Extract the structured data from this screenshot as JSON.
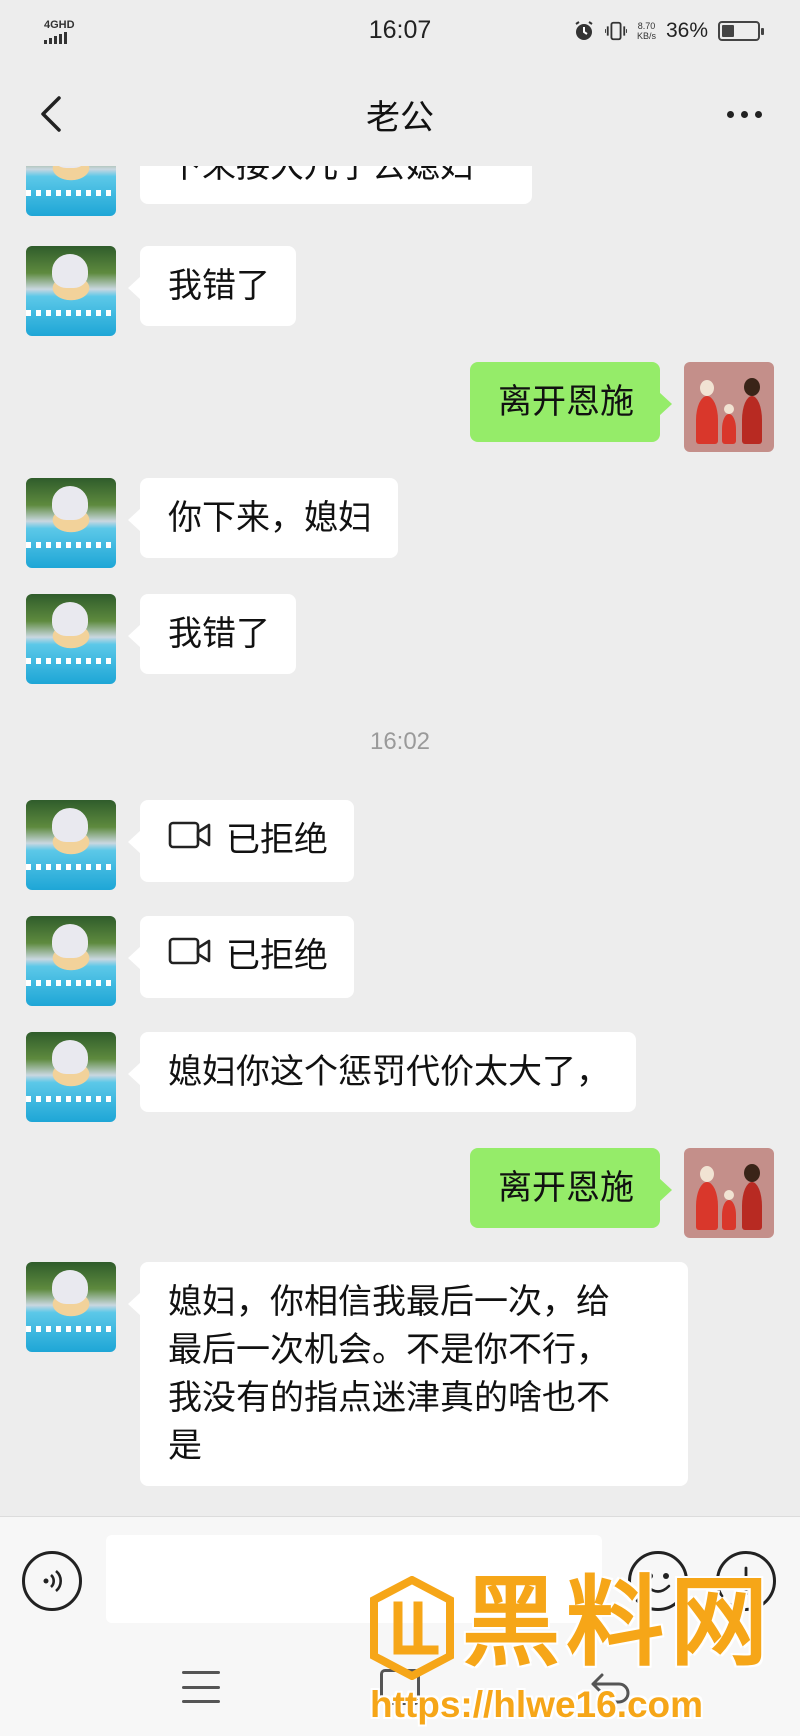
{
  "status_bar": {
    "network": "4GHD",
    "time": "16:07",
    "speed_value": "8.70",
    "speed_unit": "KB/s",
    "battery_percent": "36%",
    "battery_level": 0.36,
    "icons": [
      "signal-icon",
      "alarm-icon",
      "vibrate-icon",
      "battery-icon"
    ]
  },
  "header": {
    "title": "老公",
    "back_icon": "chevron-left-icon",
    "more_icon": "more-dots-icon"
  },
  "messages": [
    {
      "side": "left",
      "text": "下来接大儿子去媳妇"
    },
    {
      "side": "left",
      "text": "我错了"
    },
    {
      "side": "right",
      "text": "离开恩施"
    },
    {
      "side": "left",
      "text": "你下来，媳妇"
    },
    {
      "side": "left",
      "text": "我错了"
    },
    {
      "type": "timestamp",
      "text": "16:02"
    },
    {
      "side": "left",
      "type": "video_call",
      "text": "已拒绝"
    },
    {
      "side": "left",
      "type": "video_call",
      "text": "已拒绝"
    },
    {
      "side": "left",
      "text": "媳妇你这个惩罚代价太大了，"
    },
    {
      "side": "right",
      "text": "离开恩施"
    },
    {
      "side": "left",
      "lines": [
        "媳妇，你相信我最后一次，给",
        "最后一次机会。不是你不行，",
        "我没有的指点迷津真的啥也不",
        "是"
      ]
    }
  ],
  "input_bar": {
    "placeholder": "",
    "voice_icon": "voice-icon",
    "emoji_icon": "emoji-icon",
    "plus_icon": "plus-icon"
  },
  "watermark": {
    "title": "黑料网",
    "url": "https://hlwe16.com",
    "accent_color": "#f6a618"
  },
  "colors": {
    "background": "#ededed",
    "sent_bubble": "#95ec69",
    "received_bubble": "#ffffff"
  }
}
